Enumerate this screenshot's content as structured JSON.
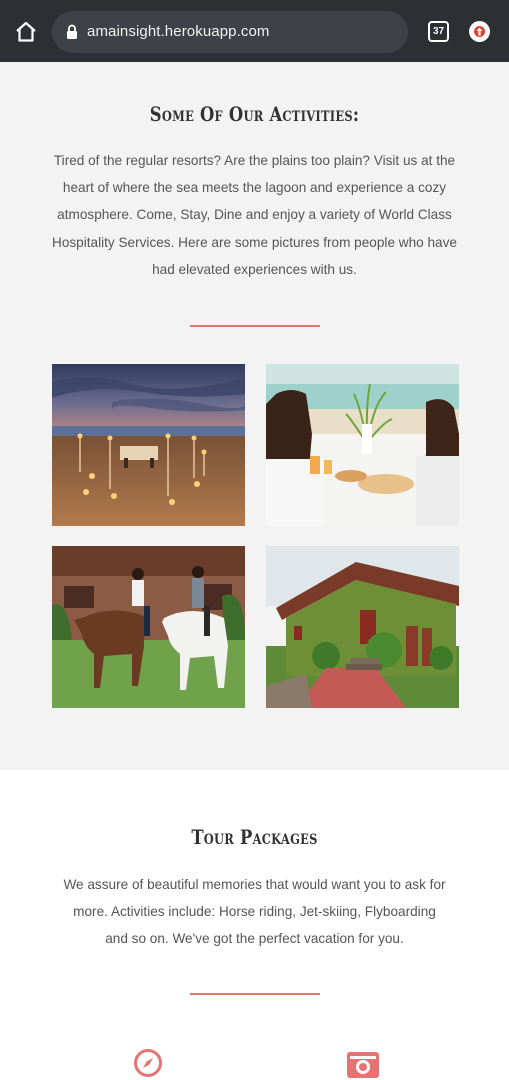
{
  "browser": {
    "url": "amainsight.herokuapp.com",
    "tab_count": "37"
  },
  "activities": {
    "title": "Some Of Our Activities:",
    "description": "Tired of the regular resorts? Are the plains too plain? Visit us at the heart of where the sea meets the lagoon and experience a cozy atmosphere. Come, Stay, Dine and enjoy a variety of World Class Hospitality Services. Here are some pictures from people who have had elevated experiences with us."
  },
  "tour": {
    "title": "Tour Packages",
    "description": "We assure of beautiful memories that would want you to ask for more. Activities include: Horse riding, Jet-skiing, Flyboarding and so on. We've got the perfect vacation for you."
  },
  "colors": {
    "accent": "#e57373",
    "chrome": "#2d2f33",
    "section_bg": "#f3f3f3"
  },
  "icons": [
    "home-icon",
    "lock-icon",
    "tabs-icon",
    "update-icon",
    "compass-icon",
    "camera-icon"
  ]
}
